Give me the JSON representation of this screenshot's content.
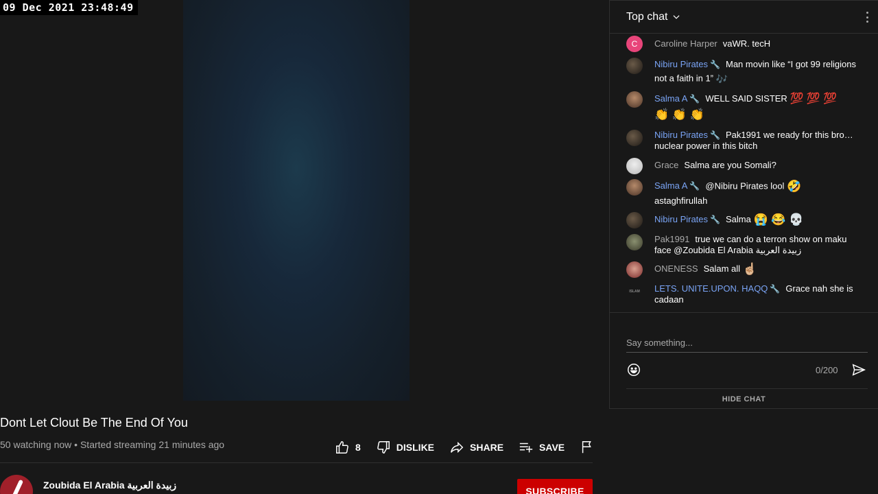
{
  "overlay": {
    "timestamp": "09 Dec 2021 23:48:49"
  },
  "video": {
    "title": "Dont Let Clout Be The End Of You",
    "meta": "50 watching now • Started streaming 21 minutes ago",
    "actions": {
      "likes": "8",
      "dislike": "DISLIKE",
      "share": "SHARE",
      "save": "SAVE"
    },
    "channel": {
      "name": "Zoubida El Arabia زبيدة العربية",
      "subscribe": "SUBSCRIBE"
    }
  },
  "chat": {
    "mode": "Top chat",
    "messages": [
      {
        "author": "Caroline Harper",
        "text": "vaWR. tecH",
        "avatar_letter": "C"
      },
      {
        "author": "Nibiru Pirates",
        "text": "Man movin like “I got 99 religions not a faith in 1”",
        "emoji": "🎶"
      },
      {
        "author": "Salma A",
        "text": "WELL SAID SISTER",
        "emoji": "💯 💯 💯",
        "emoji2": "👏 👏 👏"
      },
      {
        "author": "Nibiru Pirates",
        "text": "Pak1991 we ready for this bro… nuclear power in this bitch"
      },
      {
        "author": "Grace",
        "text": "Salma are you Somali?"
      },
      {
        "author": "Salma A",
        "text": "@Nibiru Pirates lool",
        "emoji": "🤣",
        "text2": "astaghfirullah"
      },
      {
        "author": "Nibiru Pirates",
        "text": "Salma",
        "emoji": "😭 😂 💀"
      },
      {
        "author": "Pak1991",
        "text": "true we can do a terron show on maku face @Zoubida El Arabia زبيدة العربية"
      },
      {
        "author": "ONENESS",
        "text": "Salam all",
        "emoji": "☝🏼"
      },
      {
        "author": "LETS. UNITE.UPON. HAQQ",
        "text": "Grace nah she is cadaan",
        "avatar_text": "ISLAM"
      }
    ],
    "input_placeholder": "Say something...",
    "counter": "0/200",
    "hide_chat": "HIDE CHAT"
  },
  "colors": {
    "member_name": "#7aa4f5",
    "subscribe": "#cc0000",
    "background": "#181818"
  }
}
